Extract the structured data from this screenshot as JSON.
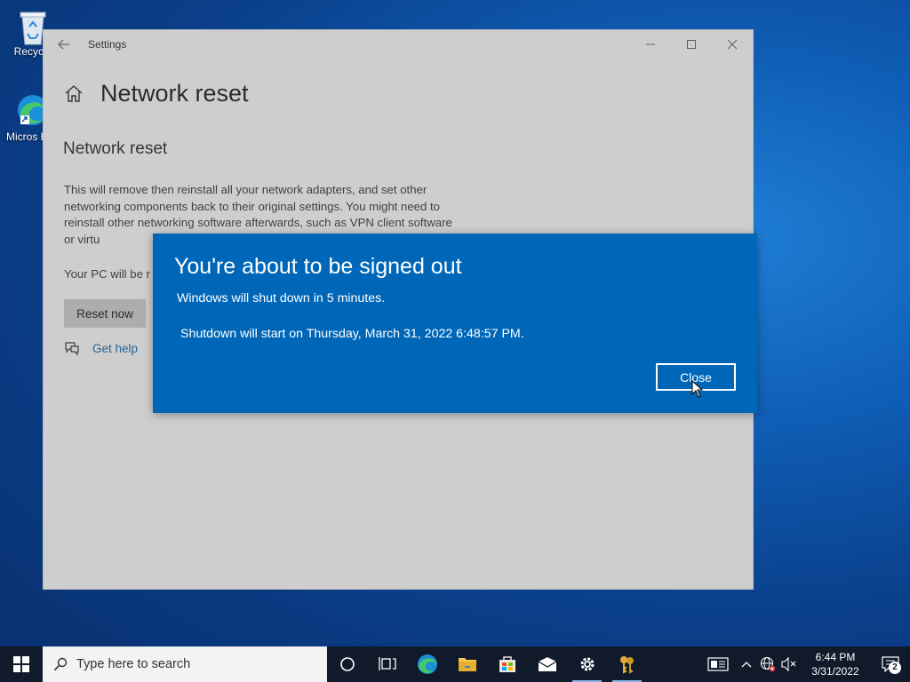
{
  "desktop": {
    "icons": [
      {
        "label": "Recycle"
      },
      {
        "label": "Micros Edg"
      }
    ]
  },
  "settings": {
    "window_title": "Settings",
    "page_title": "Network reset",
    "section_title": "Network reset",
    "description": "This will remove then reinstall all your network adapters, and set other networking components back to their original settings. You might need to reinstall other networking software afterwards, such as VPN client software or virtu",
    "restart_note": "Your PC will be r",
    "reset_button": "Reset now",
    "help_link": "Get help",
    "controls": {
      "minimize": "—",
      "maximize": "☐",
      "close": "✕"
    }
  },
  "dialog": {
    "title": "You're about to be signed out",
    "message": "Windows will shut down in 5 minutes.",
    "time_text": "Shutdown will start on Thursday, March 31, 2022 6:48:57 PM.",
    "close_button": "Close",
    "bg_color": "#0067b8"
  },
  "taskbar": {
    "search_placeholder": "Type here to search",
    "apps": [
      {
        "icon": "cortana-icon"
      },
      {
        "icon": "task-view-icon"
      },
      {
        "icon": "edge-icon"
      },
      {
        "icon": "file-explorer-icon"
      },
      {
        "icon": "store-icon"
      },
      {
        "icon": "mail-icon"
      },
      {
        "icon": "settings-gear-icon",
        "active": true
      },
      {
        "icon": "keys-app-icon",
        "active": true
      }
    ],
    "clock_time": "6:44 PM",
    "clock_date": "3/31/2022",
    "notification_count": "2"
  }
}
